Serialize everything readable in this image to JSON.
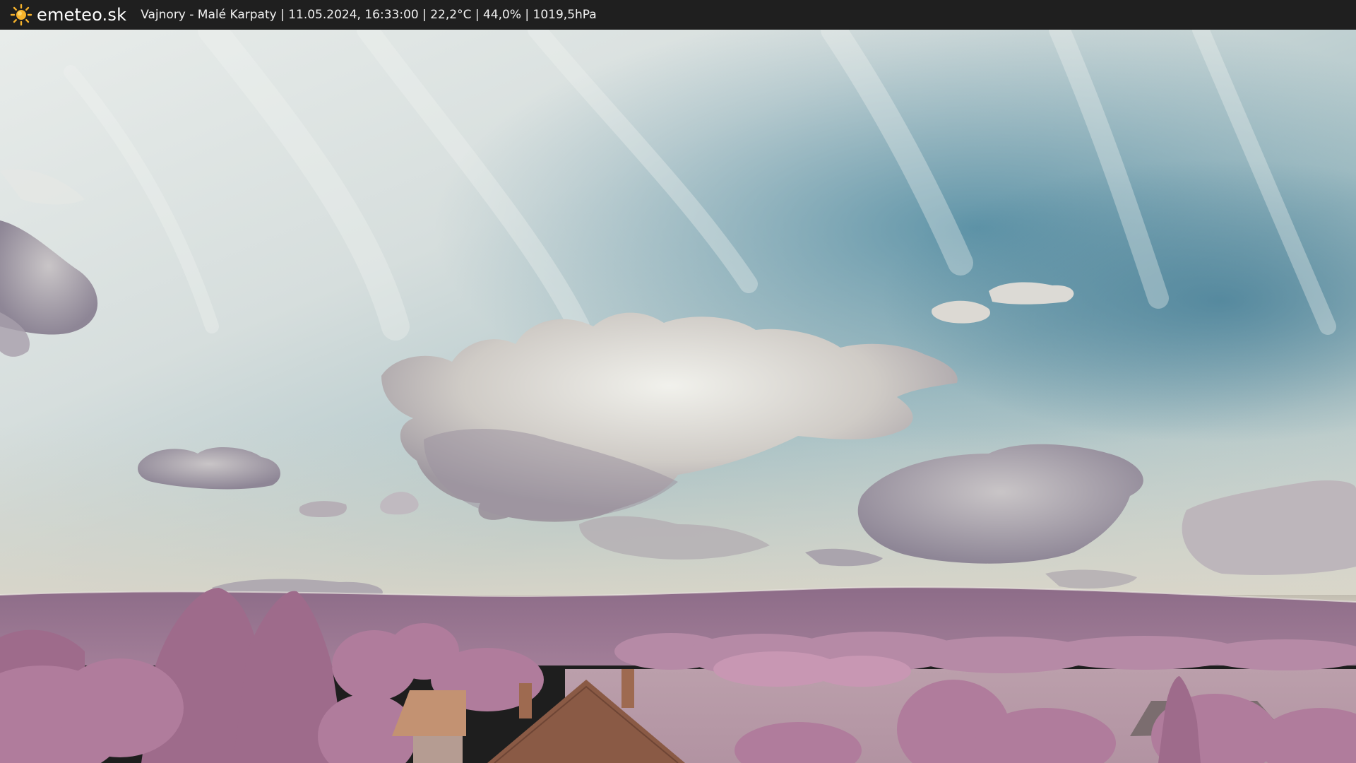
{
  "header": {
    "logo_text": "emeteo.sk",
    "logo_icon": "sun-icon",
    "status_line": "Vajnory - Malé Karpaty | 11.05.2024, 16:33:00 | 22,2°C | 44,0% | 1019,5hPa"
  },
  "colors": {
    "topbar_bg": "#1f1f1f",
    "sun_icon": "#f7b32b",
    "sky_blue": "#5e8fa3",
    "sky_light": "#dfe3df",
    "hills": "#8a6a85",
    "foliage": "#b3809f",
    "field": "#b89aa6",
    "roof": "#8a5a45"
  }
}
